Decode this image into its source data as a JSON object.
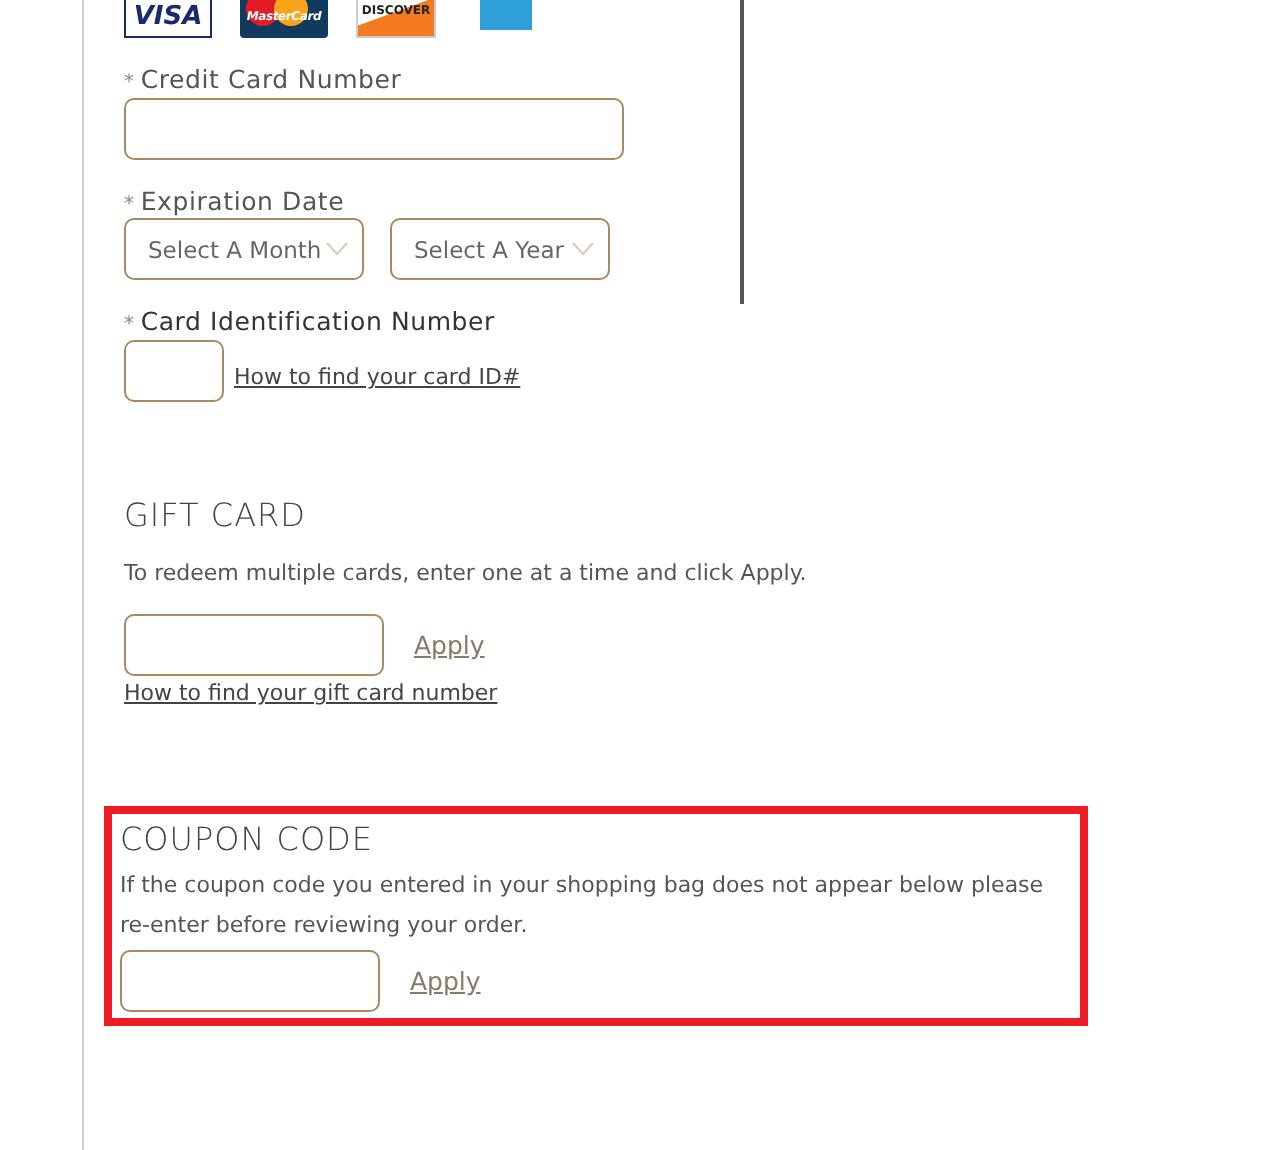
{
  "card_logos": [
    {
      "kind": "visa",
      "label": "VISA"
    },
    {
      "kind": "mastercard",
      "label": "MasterCard"
    },
    {
      "kind": "discover",
      "label": "DISCOVER"
    },
    {
      "kind": "amex"
    }
  ],
  "credit_card_number": {
    "required_mark": "*",
    "label": "Credit Card Number"
  },
  "expiration_date": {
    "required_mark": "*",
    "label": "Expiration Date",
    "month": {
      "value": "Select A Month"
    },
    "year": {
      "value": "Select A Year"
    }
  },
  "card_id": {
    "required_mark": "*",
    "label": "Card Identification Number",
    "help_link": "How to find your card ID#"
  },
  "gift_card": {
    "heading": "GIFT CARD",
    "description": "To redeem multiple cards, enter one at a time and click Apply.",
    "apply": "Apply",
    "help_link": "How to find your gift card number"
  },
  "coupon_code": {
    "highlighted": true,
    "heading": "COUPON CODE",
    "description": "If the coupon code you entered in your shopping bag does not appear below please re-enter before reviewing your order.",
    "apply": "Apply"
  }
}
